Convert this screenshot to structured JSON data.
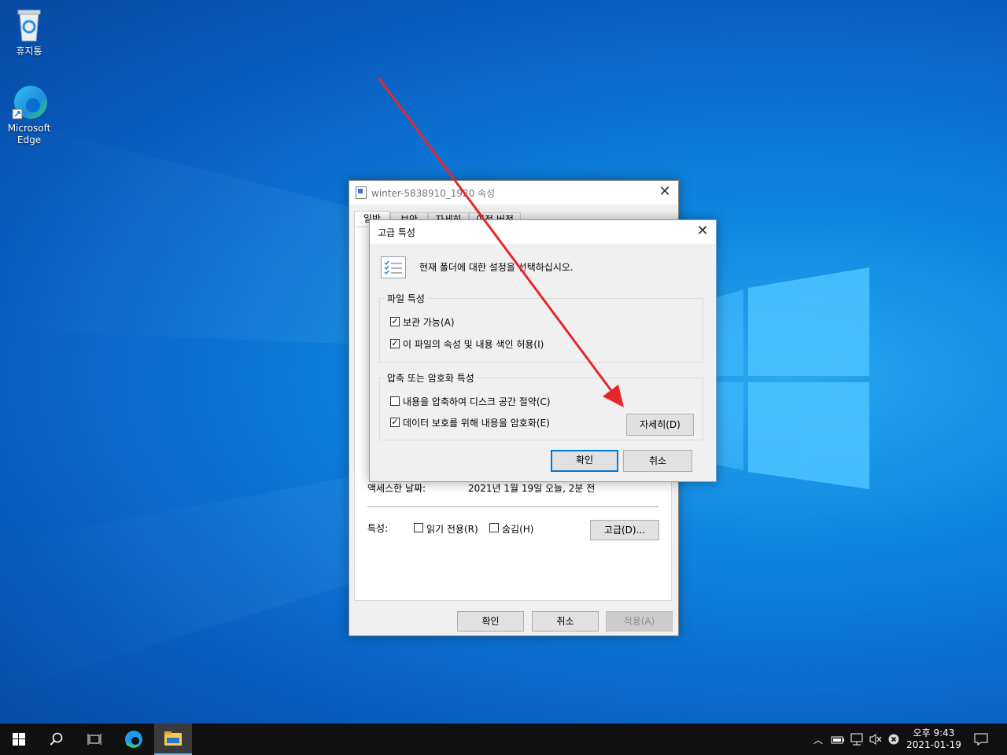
{
  "desktop": {
    "icons": [
      {
        "label": "휴지통",
        "icon": "recycle-bin-icon"
      },
      {
        "label": "Microsoft Edge",
        "icon": "edge-icon"
      }
    ]
  },
  "properties": {
    "title": "winter-5838910_1920 속성",
    "tabs": [
      "일반",
      "보안",
      "자세히",
      "이전 버전"
    ],
    "accessed_label": "액세스한 날짜:",
    "accessed_value": "2021년 1월 19일 오늘, 2분 전",
    "attributes_label": "특성:",
    "readonly_label": "읽기 전용(R)",
    "hidden_label": "숨김(H)",
    "readonly_checked": false,
    "hidden_checked": false,
    "advanced_button": "고급(D)...",
    "ok": "확인",
    "cancel": "취소",
    "apply": "적용(A)"
  },
  "advanced": {
    "title": "고급 특성",
    "description": "현재 폴더에 대한 설정을 선택하십시오.",
    "file_attributes_group": "파일 특성",
    "archive_label": "보관 가능(A)",
    "archive_checked": true,
    "index_label": "이 파일의 속성 및 내용 색인 허용(I)",
    "index_checked": true,
    "compress_group": "압축 또는 암호화 특성",
    "compress_label": "내용을 압축하여 디스크 공간 절약(C)",
    "compress_checked": false,
    "encrypt_label": "데이터 보호를 위해 내용을 암호화(E)",
    "encrypt_checked": true,
    "details_button": "자세히(D)",
    "ok": "확인",
    "cancel": "취소"
  },
  "annotation": {
    "color": "#e8262a"
  },
  "taskbar": {
    "items": [
      "windows-start-icon",
      "search-icon",
      "task-view-icon",
      "edge-icon",
      "file-explorer-icon"
    ],
    "clock_time": "오후 9:43",
    "clock_date": "2021-01-19"
  }
}
